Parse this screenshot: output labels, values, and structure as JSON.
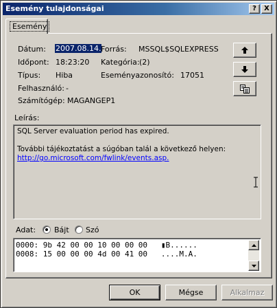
{
  "window": {
    "title": "Esemény tulajdonságai",
    "help_btn": "?",
    "close_btn": "X"
  },
  "tab": {
    "label": "Esemény"
  },
  "fields": {
    "date_label": "Dátum:",
    "date_value": "2007.08.14.",
    "time_label": "Időpont:",
    "time_value": "18:23:20",
    "type_label": "Típus:",
    "type_value": "Hiba",
    "user_label": "Felhasználó:",
    "user_value": "-",
    "computer_label": "Számítógép:",
    "computer_value": "MAGANGEP1",
    "source_label": "Forrás:",
    "source_value": "MSSQL$SQLEXPRESS",
    "category_label": "Kategória:",
    "category_value": "(2)",
    "eventid_label": "Eseményazonosító:",
    "eventid_value": "17051"
  },
  "description": {
    "label": "Leírás:",
    "line1": "SQL Server evaluation period has expired.",
    "line2": "További tájékoztatást a súgóban talál a következő helyen:",
    "link": "http://go.microsoft.com/fwlink/events.asp."
  },
  "data": {
    "label": "Adat:",
    "radio_bytes": "Bájt",
    "radio_words": "Szó",
    "selected": "Bájt",
    "lines": [
      "0000: 9b 42 00 00 10 00 00 00   ▮B......",
      "0008: 15 00 00 00 4d 00 41 00   ....M.A."
    ]
  },
  "buttons": {
    "ok": "OK",
    "cancel": "Mégse",
    "apply": "Alkalmaz"
  },
  "icons": {
    "up": "up-arrow-icon",
    "down": "down-arrow-icon",
    "copy": "copy-icon"
  }
}
